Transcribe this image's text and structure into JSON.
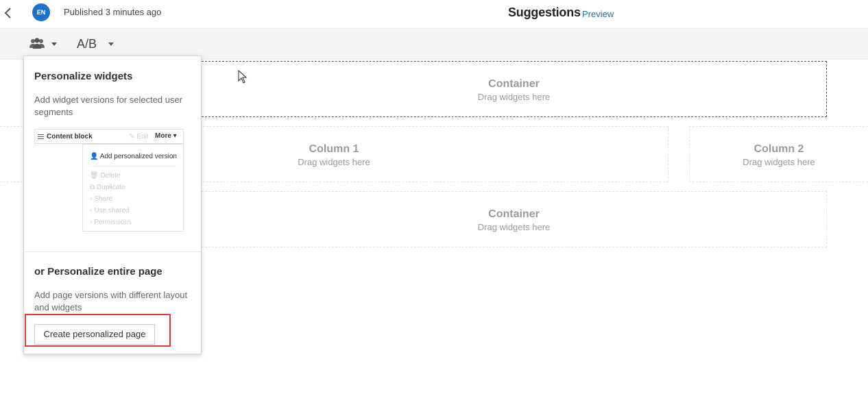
{
  "header": {
    "avatar_initials": "EN",
    "status_text": "Published 3 minutes ago",
    "page_title": "Suggestions",
    "preview_link": "Preview"
  },
  "toolbar": {
    "segments_icon": "users-icon",
    "ab_label": "A/B"
  },
  "canvas": {
    "container_top": {
      "title": "Container",
      "hint": "Drag widgets here"
    },
    "column_1": {
      "title": "Column 1",
      "hint": "Drag widgets here"
    },
    "column_2": {
      "title": "Column 2",
      "hint": "Drag widgets here"
    },
    "container_bottom": {
      "title": "Container",
      "hint": "Drag widgets here"
    }
  },
  "popover": {
    "section1_title": "Personalize widgets",
    "section1_desc": "Add widget versions for selected user segments",
    "illustration": {
      "block_label": "Content block",
      "edit_label": "Edit",
      "more_label": "More",
      "menu_primary": "Add personalized version",
      "menu_items": [
        "Delete",
        "Duplicate",
        "Share",
        "Use shared",
        "Permissions"
      ]
    },
    "section2_title": "or Personalize entire page",
    "section2_desc": "Add page versions with different layout and widgets",
    "create_button": "Create personalized page"
  },
  "colors": {
    "accent": "#1a73c9",
    "link": "#2a6db3",
    "highlight": "#e53935"
  }
}
